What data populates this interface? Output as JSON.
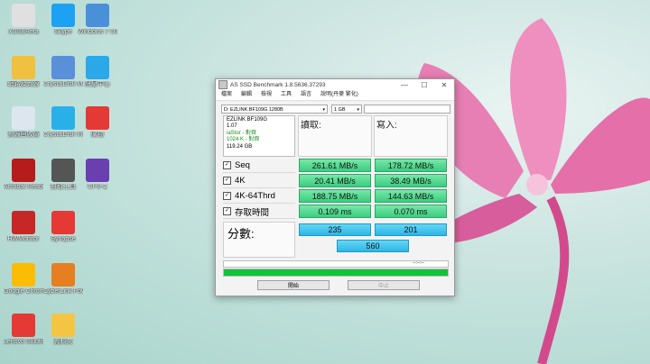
{
  "desktop": {
    "icons": [
      {
        "label": "XSSBReta",
        "color": "#e0e0e0"
      },
      {
        "label": "Skype",
        "color": "#1da1f2"
      },
      {
        "label": "Windows 7 USB DVD...",
        "color": "#4a90d9"
      },
      {
        "label": "網路及資源",
        "color": "#f0c040"
      },
      {
        "label": "CrystalDisk Mark 6...",
        "color": "#5a8fd9"
      },
      {
        "label": "訊息中心",
        "color": "#2aa8e8"
      },
      {
        "label": "資源回收筒",
        "color": "#dde6ef"
      },
      {
        "label": "CrystalDisk Info",
        "color": "#2ab0e8"
      },
      {
        "label": "購物",
        "color": "#e53935"
      },
      {
        "label": "Acrobat Reader DC",
        "color": "#b71c1c"
      },
      {
        "label": "剪取工具",
        "color": "#555"
      },
      {
        "label": "CPU-Z",
        "color": "#6a3fb0"
      },
      {
        "label": "HWMonitor",
        "color": "#c62828"
      },
      {
        "label": "Synapse",
        "color": "#e53935"
      },
      {
        "label": "Google Chrome",
        "color": "#fbbc05"
      },
      {
        "label": "CyberLink PowerDVD",
        "color": "#e67e22"
      },
      {
        "label": "Lenovo Solution...",
        "color": "#e53935"
      },
      {
        "label": "資料夾",
        "color": "#f4c542"
      }
    ]
  },
  "window": {
    "title": "AS SSD Benchmark 1.8.5636.37293",
    "controls": {
      "minimize": "—",
      "maximize": "☐",
      "close": "✕"
    },
    "menu": [
      "檔案",
      "編輯",
      "檢視",
      "工具",
      "語言",
      "說明(丹麥 繁化)"
    ],
    "drive_select": "D: EZLINK BF109G 1280B",
    "size_select": "1 GB",
    "drive_info": {
      "model": "EZLINK BF109G",
      "firmware": "1.07",
      "driver": "iaStor - 對齊",
      "alignment": "1024 K - 對齊",
      "capacity": "119.24 GB"
    },
    "read_header": "讀取:",
    "write_header": "寫入:",
    "rows": [
      {
        "label": "Seq",
        "read": "261.61 MB/s",
        "write": "178.72 MB/s"
      },
      {
        "label": "4K",
        "read": "20.41 MB/s",
        "write": "38.49 MB/s"
      },
      {
        "label": "4K-64Thrd",
        "read": "188.75 MB/s",
        "write": "144.63 MB/s"
      },
      {
        "label": "存取時間",
        "read": "0.109 ms",
        "write": "0.070 ms"
      }
    ],
    "score_label": "分數:",
    "score_read": "235",
    "score_write": "201",
    "score_total": "560",
    "progress_time": "--:--:--",
    "progress_percent": 100,
    "start_button": "開始",
    "abort_button": "中止"
  }
}
